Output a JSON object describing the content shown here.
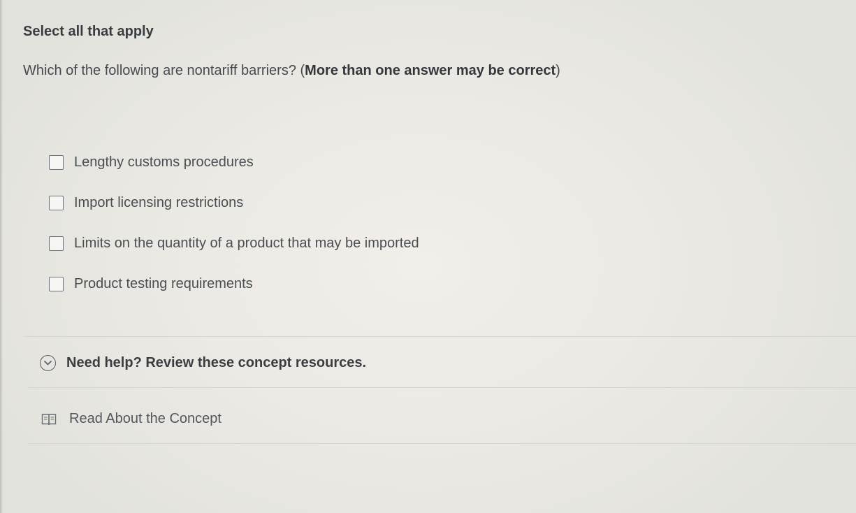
{
  "header": {
    "instruction": "Select all that apply"
  },
  "question": {
    "text": "Which of the following are nontariff barriers? (",
    "emphasis": "More than one answer may be correct",
    "close": ")"
  },
  "options": [
    {
      "label": "Lengthy customs procedures",
      "checked": false
    },
    {
      "label": "Import licensing restrictions",
      "checked": false
    },
    {
      "label": "Limits on the quantity of a product that may be imported",
      "checked": false
    },
    {
      "label": "Product testing requirements",
      "checked": false
    }
  ],
  "help": {
    "toggle_label": "Need help? Review these concept resources.",
    "toggle_icon": "chevron-down-circle-icon",
    "read_label": "Read About the Concept",
    "read_icon": "book-icon"
  }
}
